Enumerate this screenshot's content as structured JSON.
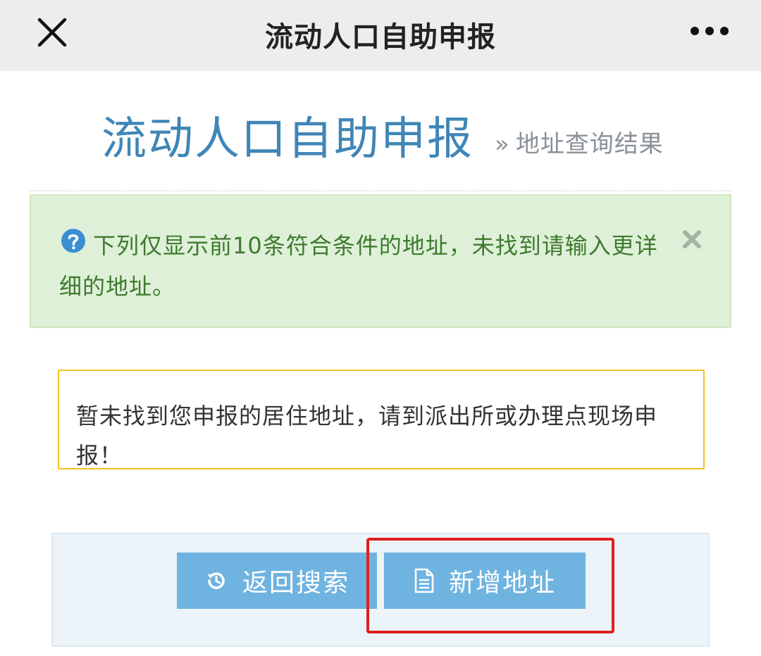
{
  "topbar": {
    "title": "流动人口自助申报",
    "close_icon": "close-icon",
    "more_icon": "more-dots-icon"
  },
  "header": {
    "title": "流动人口自助申报",
    "separator": "»",
    "subtitle": "地址查询结果"
  },
  "info_alert": {
    "icon": "question-circle-icon",
    "text": "下列仅显示前10条符合条件的地址，未找到请输入更详细的地址。",
    "dismiss_icon": "close-x-icon"
  },
  "warning_alert": {
    "text": "暂未找到您申报的居住地址，请到派出所或办理点现场申报！"
  },
  "actions": {
    "back_label": "返回搜索",
    "back_icon": "history-back-icon",
    "add_label": "新增地址",
    "add_icon": "document-icon"
  },
  "colors": {
    "topbar_bg": "#ededed",
    "title_blue": "#3f86b6",
    "success_bg": "#dff0d8",
    "success_text": "#3d7a2e",
    "warning_border": "#f2c224",
    "button_bg": "#6fb3e0",
    "highlight_red": "#e02020"
  }
}
